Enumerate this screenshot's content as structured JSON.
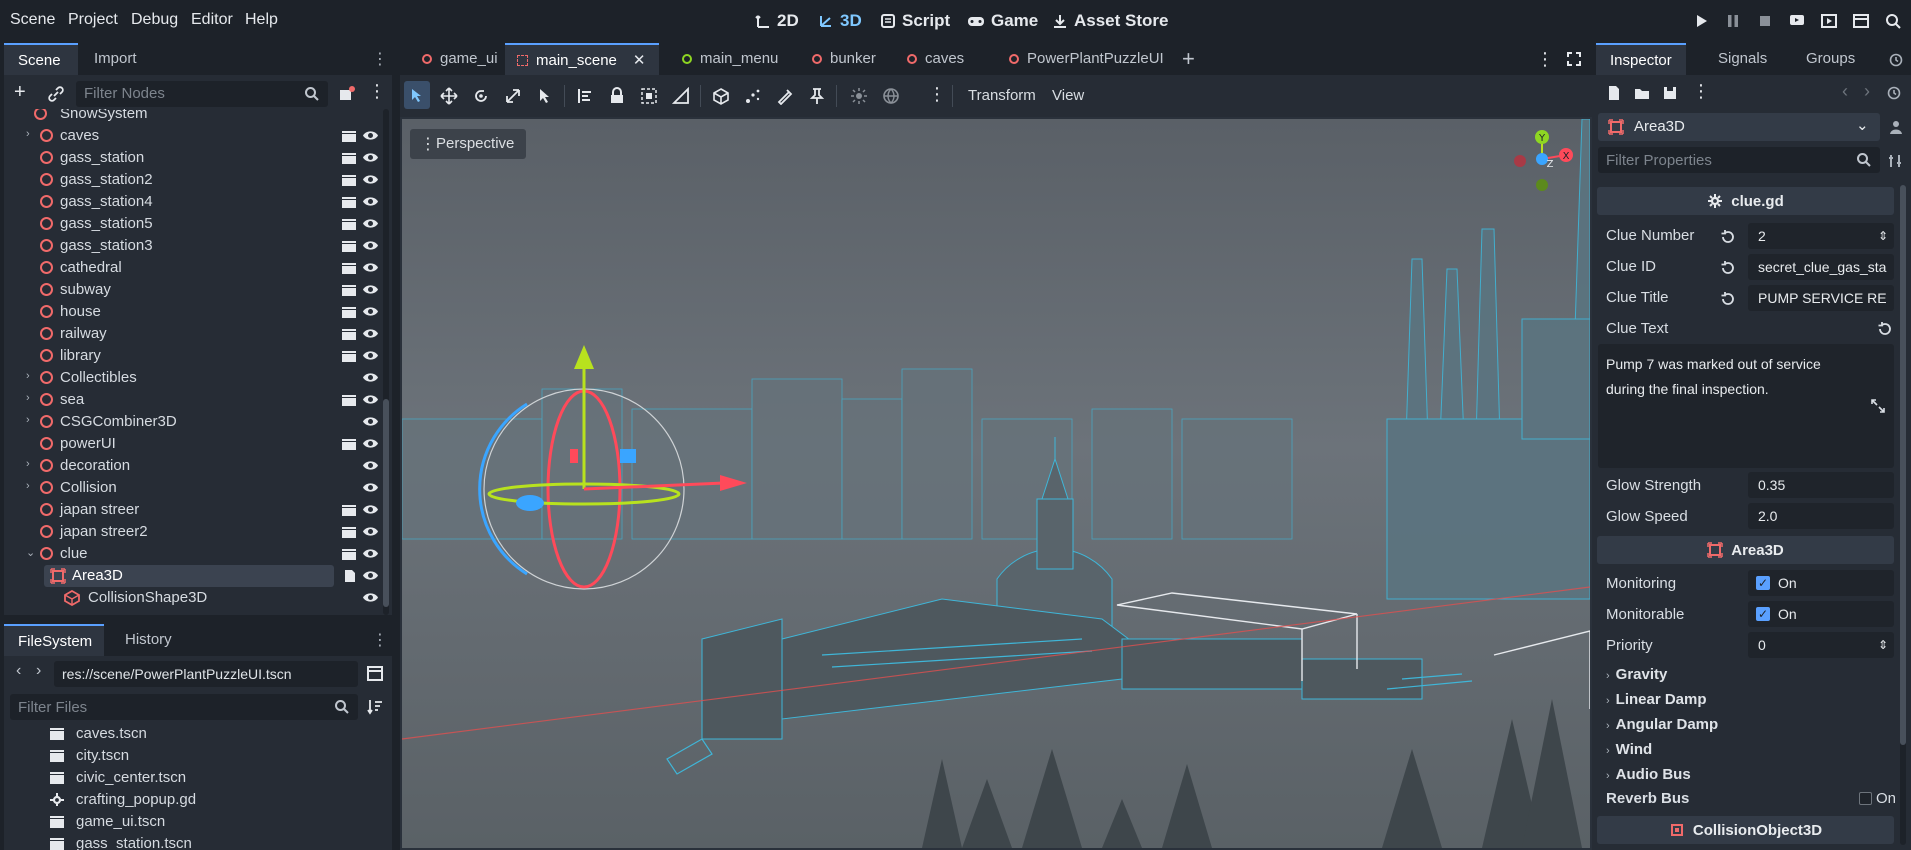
{
  "menubar": {
    "items": [
      "Scene",
      "Project",
      "Debug",
      "Editor",
      "Help"
    ],
    "workspaces": [
      "2D",
      "3D",
      "Script",
      "Game",
      "Asset Store"
    ],
    "active_workspace": "3D"
  },
  "scene_dock": {
    "tabs": [
      "Scene",
      "Import"
    ],
    "filter_placeholder": "Filter Nodes",
    "partial_top_item": "SnowSystem",
    "nodes": [
      {
        "name": "caves",
        "expandable": true,
        "clap": true
      },
      {
        "name": "gass_station",
        "expandable": false,
        "clap": true
      },
      {
        "name": "gass_station2",
        "expandable": false,
        "clap": true
      },
      {
        "name": "gass_station4",
        "expandable": false,
        "clap": true
      },
      {
        "name": "gass_station5",
        "expandable": false,
        "clap": true
      },
      {
        "name": "gass_station3",
        "expandable": false,
        "clap": true
      },
      {
        "name": "cathedral",
        "expandable": false,
        "clap": true
      },
      {
        "name": "subway",
        "expandable": false,
        "clap": true
      },
      {
        "name": "house",
        "expandable": false,
        "clap": true
      },
      {
        "name": "railway",
        "expandable": false,
        "clap": true
      },
      {
        "name": "library",
        "expandable": false,
        "clap": true
      },
      {
        "name": "Collectibles",
        "expandable": true,
        "clap": false
      },
      {
        "name": "sea",
        "expandable": true,
        "clap": true
      },
      {
        "name": "CSGCombiner3D",
        "expandable": true,
        "clap": false
      },
      {
        "name": "powerUI",
        "expandable": false,
        "clap": true
      },
      {
        "name": "decoration",
        "expandable": true,
        "clap": false
      },
      {
        "name": "Collision",
        "expandable": true,
        "clap": false
      },
      {
        "name": "japan streer",
        "expandable": false,
        "clap": true
      },
      {
        "name": "japan streer2",
        "expandable": false,
        "clap": true
      },
      {
        "name": "clue",
        "expandable": true,
        "clap": true
      }
    ],
    "selected": "Area3D",
    "child": "CollisionShape3D"
  },
  "filesystem_dock": {
    "tabs": [
      "FileSystem",
      "History"
    ],
    "path": "res://scene/PowerPlantPuzzleUI.tscn",
    "filter_placeholder": "Filter Files",
    "files": [
      "caves.tscn",
      "city.tscn",
      "civic_center.tscn",
      "crafting_popup.gd",
      "game_ui.tscn",
      "gass_station.tscn"
    ]
  },
  "scene_tabs": {
    "tabs": [
      "game_ui",
      "main_scene",
      "main_menu",
      "bunker",
      "caves",
      "PowerPlantPuzzleUI"
    ],
    "active": "main_scene"
  },
  "viewport_toolbar": {
    "transform_label": "Transform",
    "view_label": "View",
    "perspective_label": "Perspective"
  },
  "gizmo_axes": {
    "y": "Y",
    "z": "Z",
    "x": "X"
  },
  "inspector": {
    "tabs": [
      "Inspector",
      "Signals",
      "Groups"
    ],
    "node_type": "Area3D",
    "filter_placeholder": "Filter Properties",
    "script_section": "clue.gd",
    "clue_number_label": "Clue Number",
    "clue_number": "2",
    "clue_id_label": "Clue ID",
    "clue_id": "secret_clue_gas_sta",
    "clue_title_label": "Clue Title",
    "clue_title": "PUMP SERVICE RE",
    "clue_text_label": "Clue Text",
    "clue_text": "Pump 7 was marked out of service during the final inspection.",
    "glow_strength_label": "Glow Strength",
    "glow_strength": "0.35",
    "glow_speed_label": "Glow Speed",
    "glow_speed": "2.0",
    "area_section": "Area3D",
    "monitoring_label": "Monitoring",
    "monitoring_value": "On",
    "monitorable_label": "Monitorable",
    "monitorable_value": "On",
    "priority_label": "Priority",
    "priority_value": "0",
    "groups": [
      "Gravity",
      "Linear Damp",
      "Angular Damp",
      "Wind",
      "Audio Bus"
    ],
    "reverb_label": "Reverb Bus",
    "reverb_value": "On",
    "collision_section": "CollisionObject3D"
  },
  "colors": {
    "accent": "#5aa0ff",
    "node_ring": "#f06a6a",
    "wire": "#3fb6d8"
  }
}
